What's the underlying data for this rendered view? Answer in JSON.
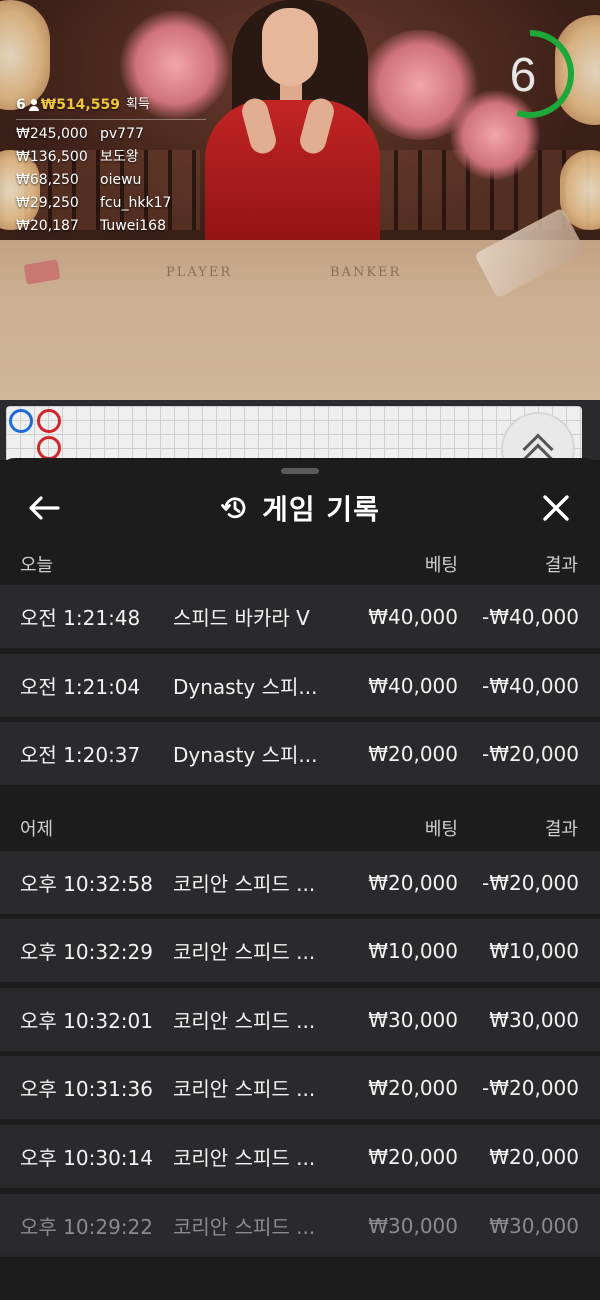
{
  "video": {
    "table_labels": {
      "player": "PLAYER",
      "banker": "BANKER"
    },
    "countdown": {
      "value": "6",
      "remaining_fraction": 0.55,
      "color": "#1fa83a"
    },
    "winners": {
      "count": "6",
      "total": "₩514,559",
      "total_label": "획득",
      "list": [
        {
          "amount": "₩245,000",
          "name": "pv777"
        },
        {
          "amount": "₩136,500",
          "name": "보도왕"
        },
        {
          "amount": "₩68,250",
          "name": "oiewu"
        },
        {
          "amount": "₩29,250",
          "name": "fcu_hkk17"
        },
        {
          "amount": "₩20,187",
          "name": "Tuwei168"
        }
      ]
    }
  },
  "roadmap": {
    "beads": [
      "player",
      "banker",
      "banker"
    ],
    "colors": {
      "player": "#1e6ad6",
      "banker": "#d2262c"
    },
    "expand_icon": "chevron-double-up-icon"
  },
  "sheet": {
    "title": "게임 기록",
    "title_icon": "history-icon",
    "back_icon": "arrow-left-icon",
    "close_icon": "close-icon",
    "sections": [
      {
        "day": "오늘",
        "bet_header": "베팅",
        "result_header": "결과",
        "rows": [
          {
            "time": "오전 1:21:48",
            "game": "스피드 바카라 V",
            "bet": "₩40,000",
            "result": "-₩40,000"
          },
          {
            "time": "오전 1:21:04",
            "game": "Dynasty 스피...",
            "bet": "₩40,000",
            "result": "-₩40,000"
          },
          {
            "time": "오전 1:20:37",
            "game": "Dynasty 스피...",
            "bet": "₩20,000",
            "result": "-₩20,000"
          }
        ]
      },
      {
        "day": "어제",
        "bet_header": "베팅",
        "result_header": "결과",
        "rows": [
          {
            "time": "오후 10:32:58",
            "game": "코리안 스피드 ...",
            "bet": "₩20,000",
            "result": "-₩20,000"
          },
          {
            "time": "오후 10:32:29",
            "game": "코리안 스피드 ...",
            "bet": "₩10,000",
            "result": "₩10,000"
          },
          {
            "time": "오후 10:32:01",
            "game": "코리안 스피드 ...",
            "bet": "₩30,000",
            "result": "₩30,000"
          },
          {
            "time": "오후 10:31:36",
            "game": "코리안 스피드 ...",
            "bet": "₩20,000",
            "result": "-₩20,000"
          },
          {
            "time": "오후 10:30:14",
            "game": "코리안 스피드 ...",
            "bet": "₩20,000",
            "result": "₩20,000"
          },
          {
            "time": "오후 10:29:22",
            "game": "코리안 스피드 ...",
            "bet": "₩30,000",
            "result": "₩30,000"
          }
        ]
      }
    ]
  }
}
